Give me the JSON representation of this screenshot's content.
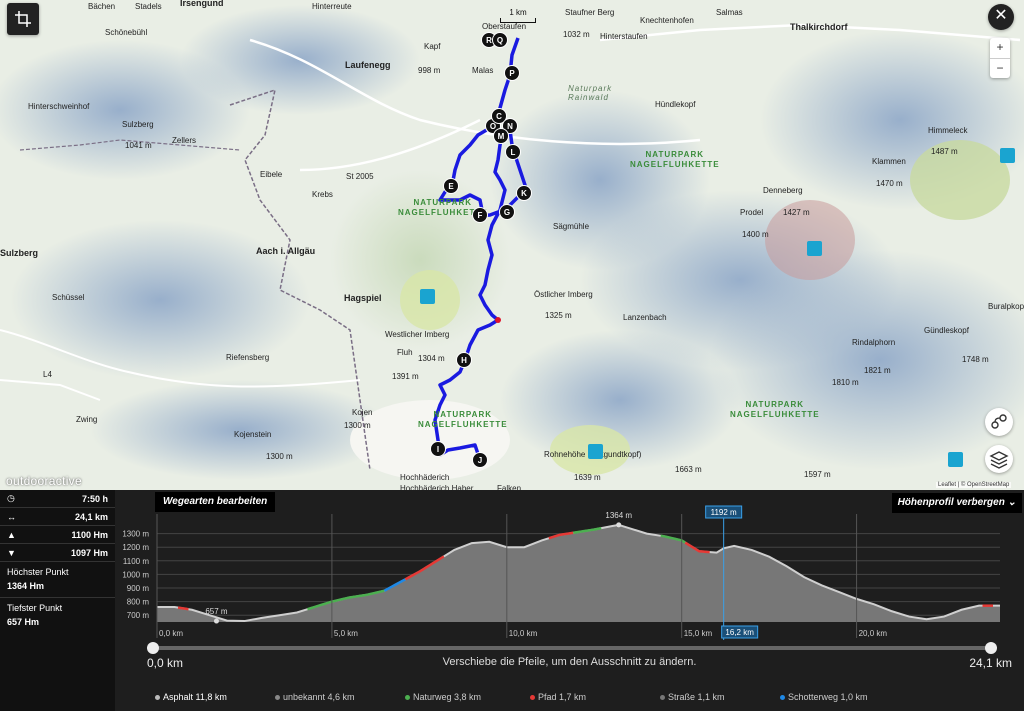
{
  "map": {
    "scale_label": "1 km",
    "brand": "outdooractive",
    "attribution": "Leaflet | © OpenStreetMap",
    "zoom_in": "+",
    "zoom_out": "−",
    "close": "✕",
    "places": [
      {
        "text": "Bächen",
        "cls": ""
      },
      {
        "text": "Stadels",
        "cls": ""
      },
      {
        "text": "Irsengund",
        "cls": "bold"
      },
      {
        "text": "Hinterreute",
        "cls": ""
      },
      {
        "text": "Oberstaufen",
        "cls": ""
      },
      {
        "text": "Staufner Berg",
        "cls": ""
      },
      {
        "text": "1032 m",
        "cls": ""
      },
      {
        "text": "Salmas",
        "cls": ""
      },
      {
        "text": "Knechtenhofen",
        "cls": ""
      },
      {
        "text": "Thalkirchdorf",
        "cls": "bold"
      },
      {
        "text": "Schönebühl",
        "cls": ""
      },
      {
        "text": "Hinterstaufen",
        "cls": ""
      },
      {
        "text": "Kapf",
        "cls": ""
      },
      {
        "text": "Laufenegg",
        "cls": "bold"
      },
      {
        "text": "998 m",
        "cls": ""
      },
      {
        "text": "Malas",
        "cls": ""
      },
      {
        "text": "Hündlekopf",
        "cls": ""
      },
      {
        "text": "Hinterschweinhof",
        "cls": ""
      },
      {
        "text": "Sulzberg",
        "cls": ""
      },
      {
        "text": "1041 m",
        "cls": ""
      },
      {
        "text": "Zellers",
        "cls": ""
      },
      {
        "text": "Himmeleck",
        "cls": ""
      },
      {
        "text": "1487 m",
        "cls": ""
      },
      {
        "text": "Klammen",
        "cls": ""
      },
      {
        "text": "1470 m",
        "cls": ""
      },
      {
        "text": "Eibele",
        "cls": ""
      },
      {
        "text": "Krebs",
        "cls": ""
      },
      {
        "text": "St 2005",
        "cls": ""
      },
      {
        "text": "Denneberg",
        "cls": ""
      },
      {
        "text": "1427 m",
        "cls": ""
      },
      {
        "text": "Prodel",
        "cls": ""
      },
      {
        "text": "1400 m",
        "cls": ""
      },
      {
        "text": "Sägmühle",
        "cls": ""
      },
      {
        "text": "Sulzberg",
        "cls": "bold"
      },
      {
        "text": "Aach i. Allgäu",
        "cls": "bold"
      },
      {
        "text": "Schüssel",
        "cls": ""
      },
      {
        "text": "Hagspiel",
        "cls": "bold"
      },
      {
        "text": "Östlicher Imberg",
        "cls": ""
      },
      {
        "text": "1325 m",
        "cls": ""
      },
      {
        "text": "Buralpkopf",
        "cls": ""
      },
      {
        "text": "Lanzenbach",
        "cls": ""
      },
      {
        "text": "Gündleskopf",
        "cls": ""
      },
      {
        "text": "Westlicher Imberg",
        "cls": ""
      },
      {
        "text": "Fluh",
        "cls": ""
      },
      {
        "text": "1304 m",
        "cls": ""
      },
      {
        "text": "Riefensberg",
        "cls": ""
      },
      {
        "text": "1391 m",
        "cls": ""
      },
      {
        "text": "Rindalphorn",
        "cls": ""
      },
      {
        "text": "1821 m",
        "cls": ""
      },
      {
        "text": "1748 m",
        "cls": ""
      },
      {
        "text": "1810 m",
        "cls": ""
      },
      {
        "text": "L4",
        "cls": ""
      },
      {
        "text": "Zwing",
        "cls": ""
      },
      {
        "text": "Kojen",
        "cls": ""
      },
      {
        "text": "1300 m",
        "cls": ""
      },
      {
        "text": "Kojenstein",
        "cls": ""
      },
      {
        "text": "1300 m",
        "cls": ""
      },
      {
        "text": "Hochhäderich",
        "cls": ""
      },
      {
        "text": "Hochhäderich Haber",
        "cls": ""
      },
      {
        "text": "Falken",
        "cls": ""
      },
      {
        "text": "Rohnehöhe (Eckgundtkopf)",
        "cls": ""
      },
      {
        "text": "1639 m",
        "cls": ""
      },
      {
        "text": "1663 m",
        "cls": ""
      },
      {
        "text": "1597 m",
        "cls": ""
      }
    ],
    "park_labels": [
      "NATURPARK\nNAGELFLUHKETTE",
      "NATURPARK\nNAGELFLUHKETTE",
      "NATURPARK\nNAGELFLUHKETTE",
      "NATURPARK\nNAGELFLUHKETTE"
    ],
    "park_italic": "Naturpark\nRainwald",
    "markers": [
      "R",
      "Q",
      "P",
      "O",
      "C",
      "N",
      "M",
      "L",
      "E",
      "F",
      "G",
      "K",
      "H",
      "I",
      "J"
    ]
  },
  "stats": {
    "duration": "7:50 h",
    "distance": "24,1 km",
    "ascent": "1100 Hm",
    "descent": "1097 Hm",
    "highest_label": "Höchster Punkt",
    "highest_value": "1364 Hm",
    "lowest_label": "Tiefster Punkt",
    "lowest_value": "657 Hm"
  },
  "profile": {
    "edit_label": "Wegearten bearbeiten",
    "hide_label": "Höhenprofil verbergen",
    "cursor_elev": "1192 m",
    "cursor_dist": "16,2 km",
    "range_start": "0,0 km",
    "range_end": "24,1 km",
    "range_hint": "Verschiebe die Pfeile, um den Ausschnitt zu ändern.",
    "legend": [
      {
        "label": "Asphalt 11,8 km",
        "color": "#bbbbbb",
        "active": true
      },
      {
        "label": "unbekannt 4,6 km",
        "color": "#888888",
        "active": false
      },
      {
        "label": "Naturweg 3,8 km",
        "color": "#4caf50",
        "active": false
      },
      {
        "label": "Pfad 1,7 km",
        "color": "#e53935",
        "active": false
      },
      {
        "label": "Straße 1,1 km",
        "color": "#777777",
        "active": false
      },
      {
        "label": "Schotterweg 1,0 km",
        "color": "#1e88e5",
        "active": false
      }
    ]
  },
  "chart_data": {
    "type": "area",
    "title": "",
    "xlabel": "",
    "ylabel": "",
    "x_ticks": [
      "0,0 km",
      "5,0 km",
      "10,0 km",
      "15,0 km",
      "20,0 km"
    ],
    "y_ticks": [
      "1300 m",
      "1200 m",
      "1100 m",
      "1000 m",
      "900 m",
      "800 m",
      "700 m"
    ],
    "xlim": [
      0,
      24.1
    ],
    "ylim": [
      650,
      1400
    ],
    "annotations": [
      {
        "x": 13.2,
        "y": 1364,
        "text": "1364 m"
      },
      {
        "x": 1.7,
        "y": 657,
        "text": "657 m"
      }
    ],
    "series": [
      {
        "x": [
          0,
          0.5,
          1,
          1.5,
          2,
          2.5,
          3,
          3.5,
          4,
          4.5,
          5,
          5.5,
          6,
          6.5,
          7,
          7.5,
          8,
          8.5,
          9,
          9.5,
          10,
          10.5,
          11,
          11.5,
          12,
          12.5,
          13,
          13.2,
          13.5,
          14,
          14.5,
          15,
          15.5,
          16,
          16.2,
          16.5,
          17,
          17.5,
          18,
          18.5,
          19,
          19.5,
          20,
          20.5,
          21,
          21.5,
          22,
          22.5,
          23,
          23.5,
          24.1
        ],
        "y": [
          760,
          760,
          740,
          700,
          660,
          657,
          680,
          700,
          720,
          760,
          800,
          830,
          850,
          880,
          950,
          1020,
          1100,
          1180,
          1230,
          1240,
          1200,
          1200,
          1250,
          1290,
          1310,
          1330,
          1355,
          1364,
          1340,
          1300,
          1280,
          1250,
          1170,
          1160,
          1192,
          1210,
          1180,
          1130,
          1060,
          980,
          920,
          870,
          820,
          780,
          730,
          690,
          670,
          690,
          740,
          770,
          770
        ]
      }
    ]
  }
}
